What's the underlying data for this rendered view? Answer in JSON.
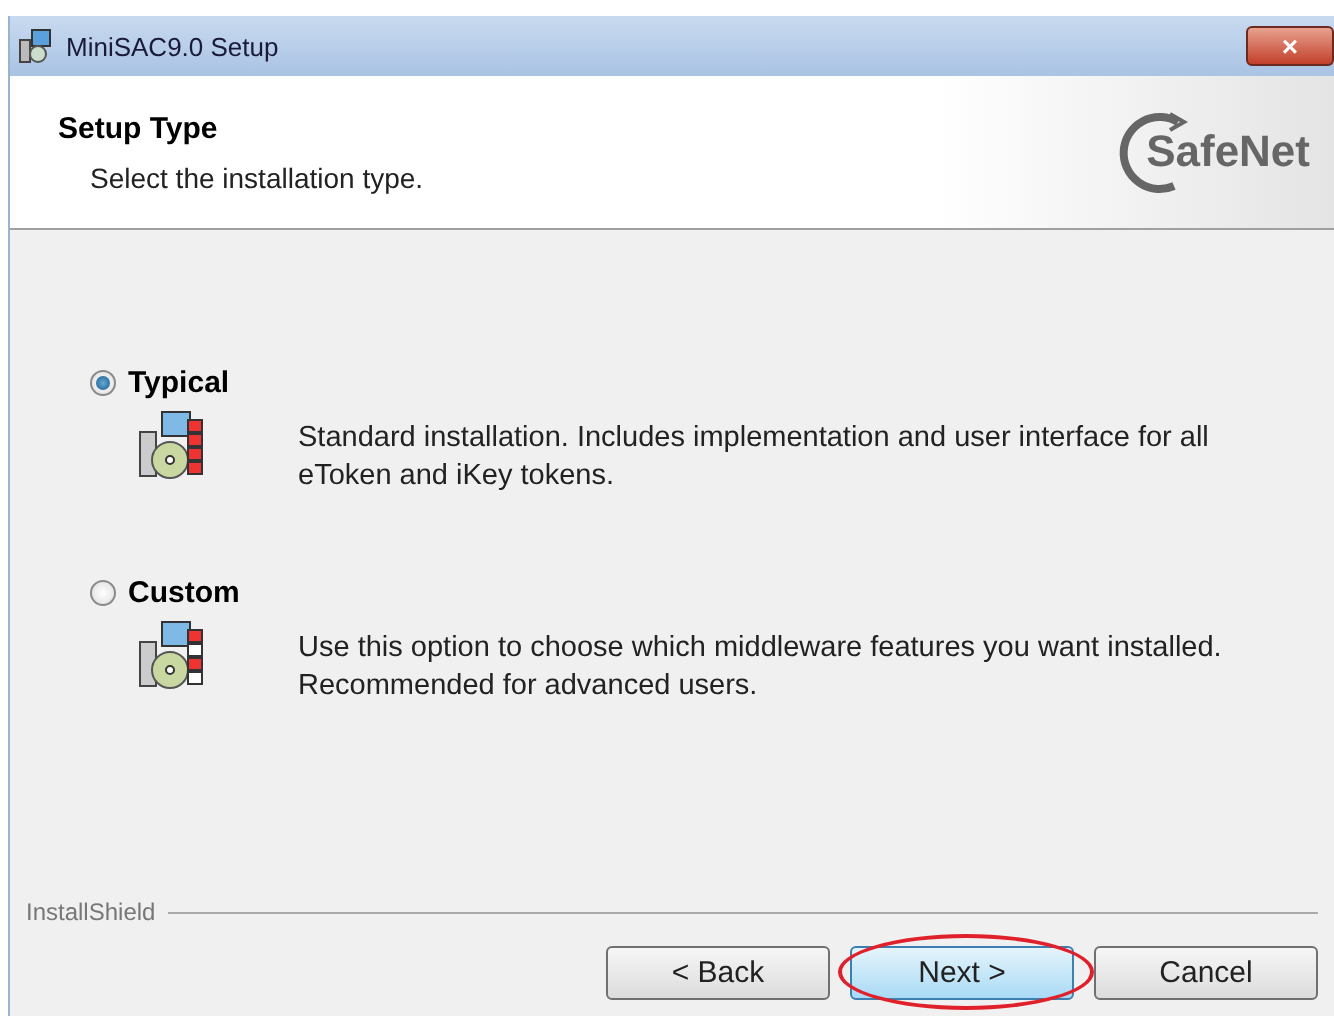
{
  "window": {
    "title": "MiniSAC9.0 Setup",
    "close": "×"
  },
  "header": {
    "title": "Setup Type",
    "subtitle": "Select the installation type.",
    "logo": "SafeNet"
  },
  "options": [
    {
      "label": "Typical",
      "selected": true,
      "description": "Standard installation. Includes implementation and user interface for all eToken and iKey tokens.",
      "full": true
    },
    {
      "label": "Custom",
      "selected": false,
      "description": "Use this option to choose which middleware features you want installed. Recommended for advanced users.",
      "full": false
    }
  ],
  "footer": {
    "brand": "InstallShield"
  },
  "buttons": [
    {
      "label": "< Back",
      "default": false,
      "highlighted": false
    },
    {
      "label": "Next >",
      "default": true,
      "highlighted": true
    },
    {
      "label": "Cancel",
      "default": false,
      "highlighted": false
    }
  ]
}
